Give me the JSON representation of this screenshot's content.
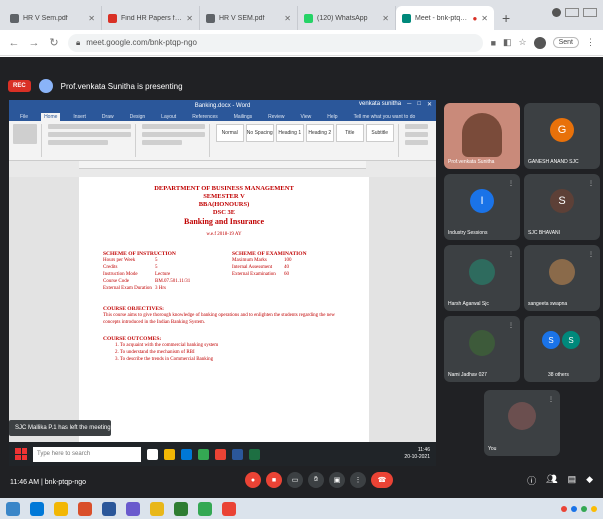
{
  "browser": {
    "tabs": [
      {
        "title": "HR V Sem.pdf",
        "color": "#5f6368"
      },
      {
        "title": "Find HR Papers for Downloa",
        "color": "#d93025"
      },
      {
        "title": "HR V SEM.pdf",
        "color": "#5f6368"
      },
      {
        "title": "(120) WhatsApp",
        "color": "#25d366"
      },
      {
        "title": "Meet - bnk-ptqp-ngo",
        "color": "#00897b"
      }
    ],
    "url": "meet.google.com/bnk-ptqp-ngo",
    "profile_label": "Sent"
  },
  "meet": {
    "rec_label": "REC",
    "presenting_text": "Prof.venkata Sunitha is presenting",
    "meeting_time": "11:46 AM",
    "meeting_code": "bnk-ptqp-ngo",
    "toast": "SJC Mallika P.1 has left the meeting"
  },
  "word": {
    "title_bar": "Banking.docx - Word",
    "user": "venkata sunitha",
    "tabs": [
      "File",
      "Home",
      "Insert",
      "Draw",
      "Design",
      "Layout",
      "References",
      "Mailings",
      "Review",
      "View",
      "Help"
    ],
    "active_tab": "Home",
    "tell_me": "Tell me what you want to do",
    "styles": [
      "Normal",
      "No Spacing",
      "Heading 1",
      "Heading 2",
      "Title",
      "Subtitle"
    ]
  },
  "document": {
    "dept": "DEPARTMENT OF BUSINESS MANAGEMENT",
    "semester": "SEMESTER V",
    "program": "BBA(HONOURS)",
    "code": "DSC 3E",
    "course": "Banking and Insurance",
    "year": "w.e.f 2018-19 AY",
    "left_heading": "SCHEME OF INSTRUCTION",
    "left_rows": [
      {
        "k": "Hours per Week",
        "v": "5"
      },
      {
        "k": "Credits",
        "v": "5"
      },
      {
        "k": "Instruction Mode",
        "v": "Lecture"
      },
      {
        "k": "Course Code",
        "v": "BM.07.501.11/31"
      },
      {
        "k": "External Exam Duration",
        "v": "3 Hrs"
      }
    ],
    "right_heading": "SCHEME OF EXAMINATION",
    "right_rows": [
      {
        "k": "Maximum Marks",
        "v": "100"
      },
      {
        "k": "Internal Assessment",
        "v": "40"
      },
      {
        "k": "External Examination",
        "v": "60"
      }
    ],
    "objectives_heading": "COURSE OBJECTIVES:",
    "objectives_text": "This course aims to give thorough knowledge of banking operations and to enlighten the students regarding the new concepts introduced in the Indian Banking System.",
    "outcomes_heading": "COURSE OUTCOMES:",
    "outcomes": [
      "1.  To acquaint with the commercial banking system",
      "2.  To understand the mechanism of RBI",
      "3.  To describe the trends in Commercial Banking"
    ]
  },
  "taskbar": {
    "search_placeholder": "Type here to search",
    "time": "11:46",
    "date": "20-10-2021"
  },
  "participants": [
    {
      "name": "Prof.venkata Sunitha",
      "type": "video",
      "bg": "#c98a7a"
    },
    {
      "name": "GANESH ANAND SJC",
      "type": "initial",
      "initial": "G",
      "color": "#e8710a"
    },
    {
      "name": "Industry Sessions",
      "type": "initial",
      "initial": "I",
      "color": "#1a73e8"
    },
    {
      "name": "SJC BHAVANI",
      "type": "initial",
      "initial": "S",
      "color": "#5d4037"
    },
    {
      "name": "Harsh Agarwal Sjc",
      "type": "photo",
      "bg": "#2e6b5e"
    },
    {
      "name": "sangeeta swapna",
      "type": "photo",
      "bg": "#8a6a4a"
    },
    {
      "name": "Nami Jadhav 027",
      "type": "photo",
      "bg": "#3d5a3a"
    },
    {
      "name": "38 others",
      "type": "others",
      "initial": "S",
      "color": "#1a73e8"
    },
    {
      "name": "You",
      "type": "photo",
      "bg": "#6b4f4f"
    }
  ]
}
